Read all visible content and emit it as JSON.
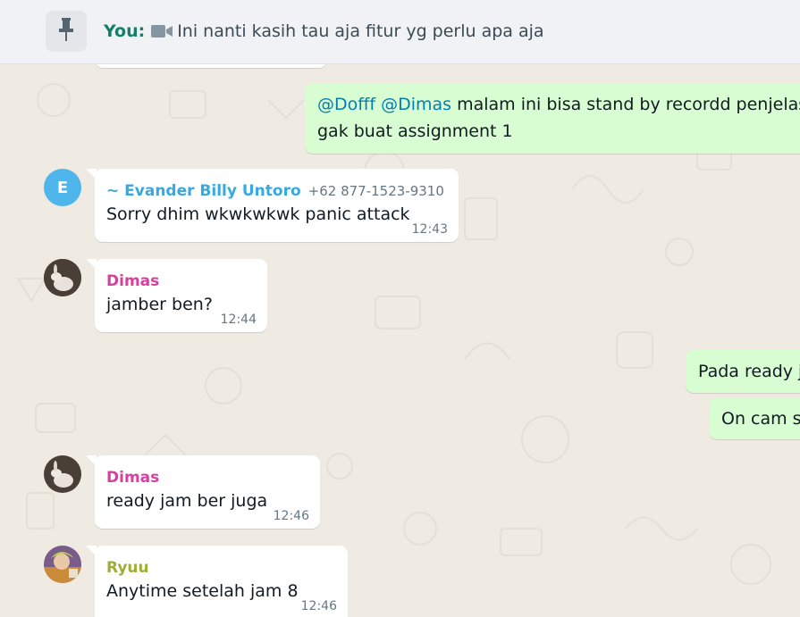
{
  "pinned": {
    "sender": "You:",
    "text": "Ini nanti kasih tau aja fitur yg perlu apa aja"
  },
  "messages": [
    {
      "direction": "out",
      "mentions": [
        "@Dofff",
        "@Dimas"
      ],
      "line1_rest": " malam ini bisa stand by recordd penjelas",
      "line2": "gak buat assignment 1"
    },
    {
      "direction": "in",
      "avatar_letter": "E",
      "sender": "~ Evander Billy Untoro",
      "phone": "+62 877-1523-9310",
      "text": "Sorry dhim wkwkwkwk panic attack",
      "time": "12:43",
      "sender_color": "#35a9e0"
    },
    {
      "direction": "in",
      "sender": "Dimas",
      "text": "jamber ben?",
      "time": "12:44",
      "sender_color": "#d6409f"
    },
    {
      "direction": "out",
      "text": "Pada ready j"
    },
    {
      "direction": "out",
      "text": "On cam s"
    },
    {
      "direction": "in",
      "sender": "Dimas",
      "text": "ready jam ber juga",
      "time": "12:46",
      "sender_color": "#d6409f"
    },
    {
      "direction": "in",
      "sender": "Ryuu",
      "text": "Anytime setelah jam 8",
      "time": "12:46",
      "sender_color": "#9ead35"
    }
  ],
  "icons": {
    "pin": "pin-icon",
    "video": "video-camera-icon"
  },
  "colors": {
    "chat_bg": "#efeae2",
    "incoming": "#ffffff",
    "outgoing": "#d9fdd3",
    "mention": "#027eb5"
  }
}
